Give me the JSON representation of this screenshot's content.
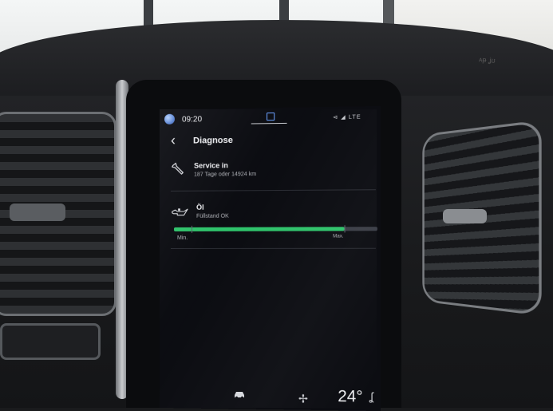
{
  "status_bar": {
    "time": "09:20",
    "signal": "⊲ ◢ LTE"
  },
  "header": {
    "back_icon": "chevron-left-icon",
    "title": "Diagnose"
  },
  "service": {
    "icon": "wrench-icon",
    "title": "Service in",
    "detail": "187 Tage oder 14924 km"
  },
  "oil": {
    "icon": "oil-can-icon",
    "title": "Öl",
    "status": "Füllstand OK",
    "level_fraction": 0.84,
    "min_label": "Min.",
    "max_label": "Max.",
    "bar_color": "#2fc36b"
  },
  "climate": {
    "fan_icon": "fan-icon",
    "temperature": "24°",
    "seat_icon": "seat-heating-icon",
    "car_icon": "car-icon"
  },
  "colors": {
    "screen_bg": "#0c0d12",
    "accent_green": "#2fc36b",
    "text_primary": "#f1f2f5",
    "text_secondary": "#aeb0b6"
  }
}
